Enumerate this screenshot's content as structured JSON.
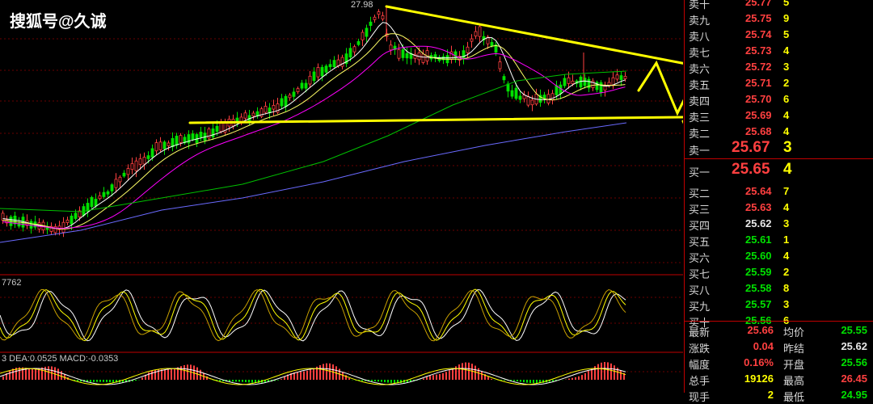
{
  "watermark": "搜狐号@久诚",
  "chart": {
    "peak_label": "27.98",
    "kdj_label": "7762",
    "macd_label": "3 DEA:0.0525 MACD:-0.0353"
  },
  "colors": {
    "up": "#ff4040",
    "down": "#00e000",
    "flat": "#e8e8e8",
    "volume": "#ffff00",
    "border": "#c00000",
    "trendline": "#ffff00"
  },
  "asks": [
    {
      "label": "卖十",
      "price": "25.77",
      "vol": "5",
      "color": "red"
    },
    {
      "label": "卖九",
      "price": "25.75",
      "vol": "9",
      "color": "red"
    },
    {
      "label": "卖八",
      "price": "25.74",
      "vol": "5",
      "color": "red"
    },
    {
      "label": "卖七",
      "price": "25.73",
      "vol": "4",
      "color": "red"
    },
    {
      "label": "卖六",
      "price": "25.72",
      "vol": "3",
      "color": "red"
    },
    {
      "label": "卖五",
      "price": "25.71",
      "vol": "2",
      "color": "red"
    },
    {
      "label": "卖四",
      "price": "25.70",
      "vol": "6",
      "color": "red"
    },
    {
      "label": "卖三",
      "price": "25.69",
      "vol": "4",
      "color": "red"
    },
    {
      "label": "卖二",
      "price": "25.68",
      "vol": "4",
      "color": "red"
    },
    {
      "label": "卖一",
      "price": "25.67",
      "vol": "3",
      "color": "red"
    }
  ],
  "bids": [
    {
      "label": "买一",
      "price": "25.65",
      "vol": "4",
      "color": "red"
    },
    {
      "label": "买二",
      "price": "25.64",
      "vol": "7",
      "color": "red"
    },
    {
      "label": "买三",
      "price": "25.63",
      "vol": "4",
      "color": "red"
    },
    {
      "label": "买四",
      "price": "25.62",
      "vol": "3",
      "color": "white"
    },
    {
      "label": "买五",
      "price": "25.61",
      "vol": "1",
      "color": "green"
    },
    {
      "label": "买六",
      "price": "25.60",
      "vol": "4",
      "color": "green"
    },
    {
      "label": "买七",
      "price": "25.59",
      "vol": "2",
      "color": "green"
    },
    {
      "label": "买八",
      "price": "25.58",
      "vol": "8",
      "color": "green"
    },
    {
      "label": "买九",
      "price": "25.57",
      "vol": "3",
      "color": "green"
    },
    {
      "label": "买十",
      "price": "25.56",
      "vol": "6",
      "color": "green"
    }
  ],
  "stats": [
    {
      "label": "最新",
      "value": "25.66",
      "color": "red"
    },
    {
      "label": "均价",
      "value": "25.55",
      "color": "green"
    },
    {
      "label": "涨跌",
      "value": "0.04",
      "color": "red"
    },
    {
      "label": "昨结",
      "value": "25.62",
      "color": "white"
    },
    {
      "label": "幅度",
      "value": "0.16%",
      "color": "red"
    },
    {
      "label": "开盘",
      "value": "25.56",
      "color": "green"
    },
    {
      "label": "总手",
      "value": "19126",
      "color": "yellow"
    },
    {
      "label": "最高",
      "value": "26.45",
      "color": "red"
    },
    {
      "label": "现手",
      "value": "2",
      "color": "yellow"
    },
    {
      "label": "最低",
      "value": "24.95",
      "color": "green"
    }
  ]
}
